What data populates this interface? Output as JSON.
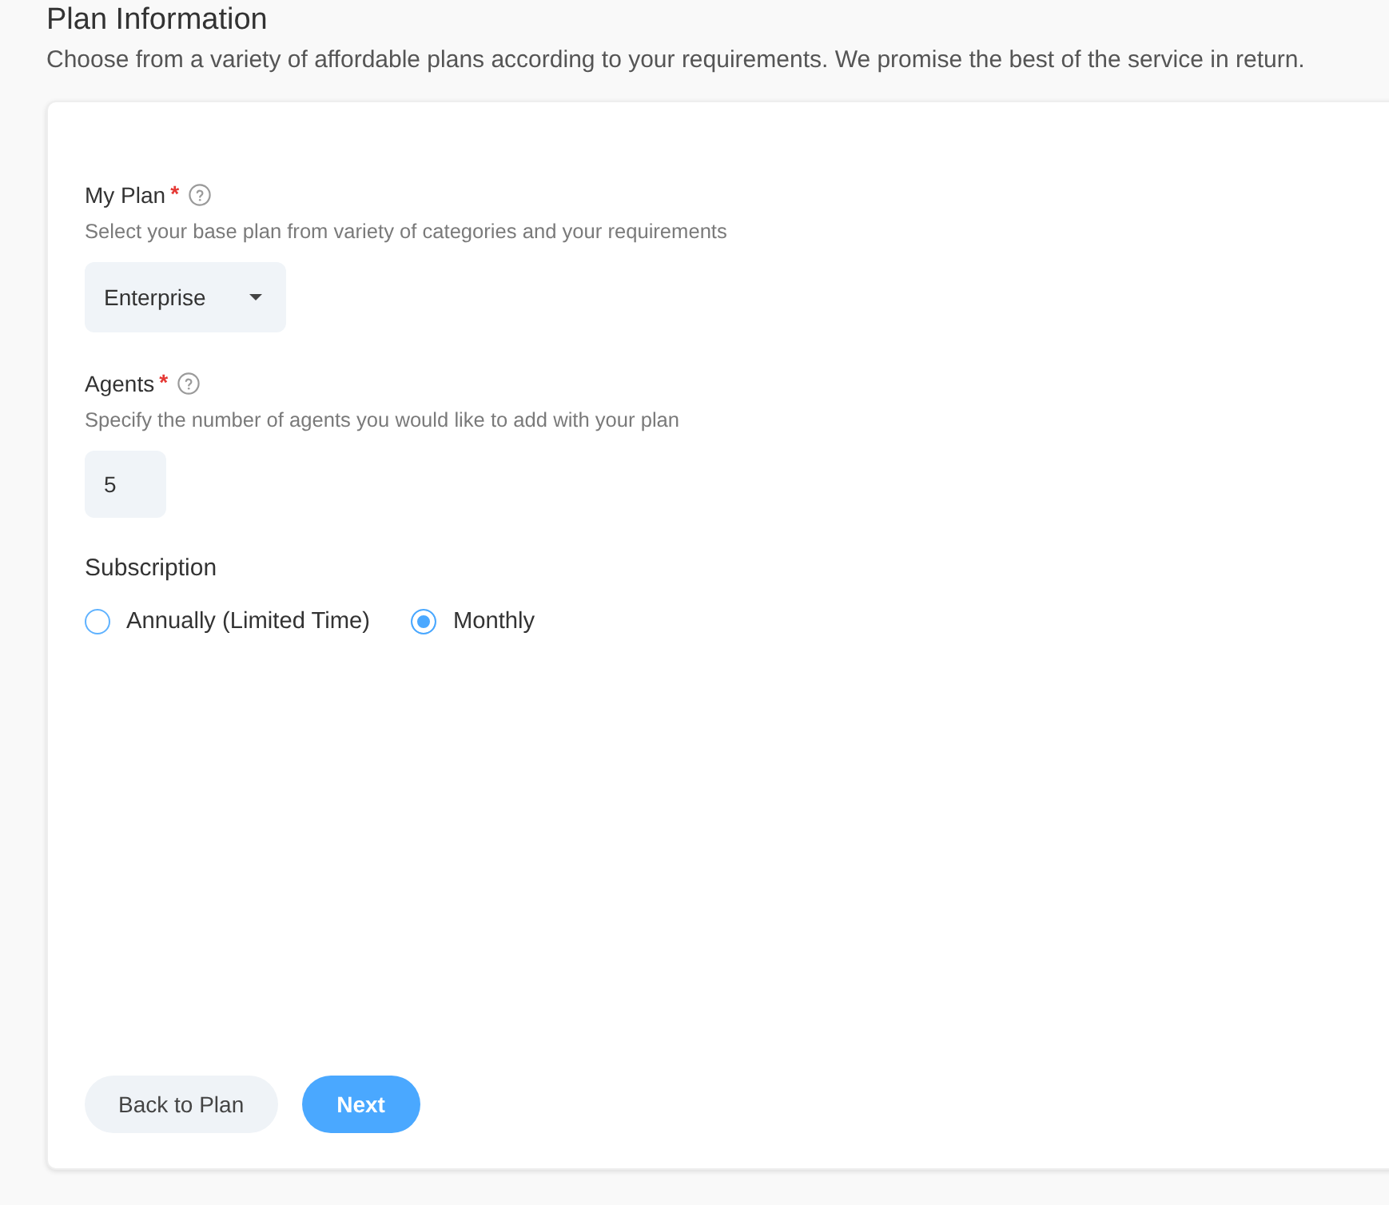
{
  "header": {
    "title": "Plan Information",
    "description": "Choose from a variety of affordable plans according to your requirements. We promise the best of the service in return."
  },
  "fields": [
    {
      "kind": "select",
      "label": "My Plan",
      "required_mark": "*",
      "description": "Select your base plan from variety of categories and your requirements",
      "value": "Enterprise"
    },
    {
      "kind": "number",
      "label": "Agents",
      "required_mark": "*",
      "description": "Specify the number of agents you would like to add with your plan",
      "value": "5"
    }
  ],
  "subscription": {
    "label": "Subscription",
    "options": [
      {
        "label": "Annually (Limited Time)",
        "selected": false
      },
      {
        "label": "Monthly",
        "selected": true
      }
    ]
  },
  "buttons": [
    {
      "label": "Back to Plan",
      "kind": "secondary"
    },
    {
      "label": "Next",
      "kind": "primary"
    }
  ]
}
